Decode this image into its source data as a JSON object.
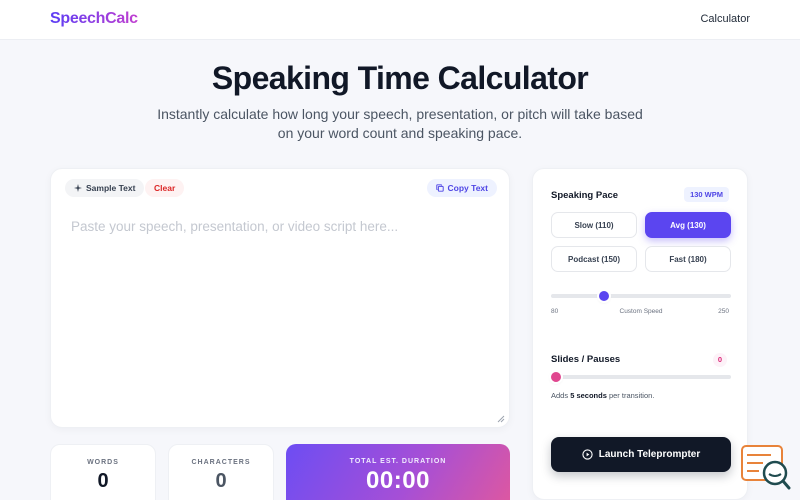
{
  "header": {
    "logo_text": "SpeechCalc",
    "nav_link": "Calculator"
  },
  "hero": {
    "title": "Speaking Time Calculator",
    "subtitle": "Instantly calculate how long your speech, presentation, or pitch will take based on your word count and speaking pace."
  },
  "editor": {
    "sample_label": "Sample Text",
    "clear_label": "Clear",
    "copy_label": "Copy Text",
    "placeholder": "Paste your speech, presentation, or video script here...",
    "value": ""
  },
  "stats": {
    "words_label": "WORDS",
    "words_value": "0",
    "chars_label": "CHARACTERS",
    "chars_value": "0",
    "duration_label": "TOTAL EST. DURATION",
    "duration_value": "00:00"
  },
  "pace": {
    "label": "Speaking Pace",
    "badge": "130 WPM",
    "options": [
      {
        "label": "Slow (110)",
        "active": false
      },
      {
        "label": "Avg (130)",
        "active": true
      },
      {
        "label": "Podcast (150)",
        "active": false
      },
      {
        "label": "Fast (180)",
        "active": false
      }
    ],
    "slider": {
      "min": 80,
      "max": 250,
      "value": 130
    },
    "min_label": "80",
    "custom_label": "Custom Speed",
    "max_label": "250"
  },
  "slides": {
    "label": "Slides / Pauses",
    "count": "0",
    "slider_value": 0,
    "note_prefix": "Adds ",
    "note_bold": "5 seconds",
    "note_suffix": " per transition."
  },
  "launch_label": "Launch Teleprompter",
  "colors": {
    "accent": "#5b45f0",
    "pink": "#e0478f",
    "dark": "#111827"
  },
  "icons": {
    "sample": "sparkle-icon",
    "copy": "copy-icon",
    "launch": "play-circle-icon",
    "widget": "chat-search-icon"
  }
}
